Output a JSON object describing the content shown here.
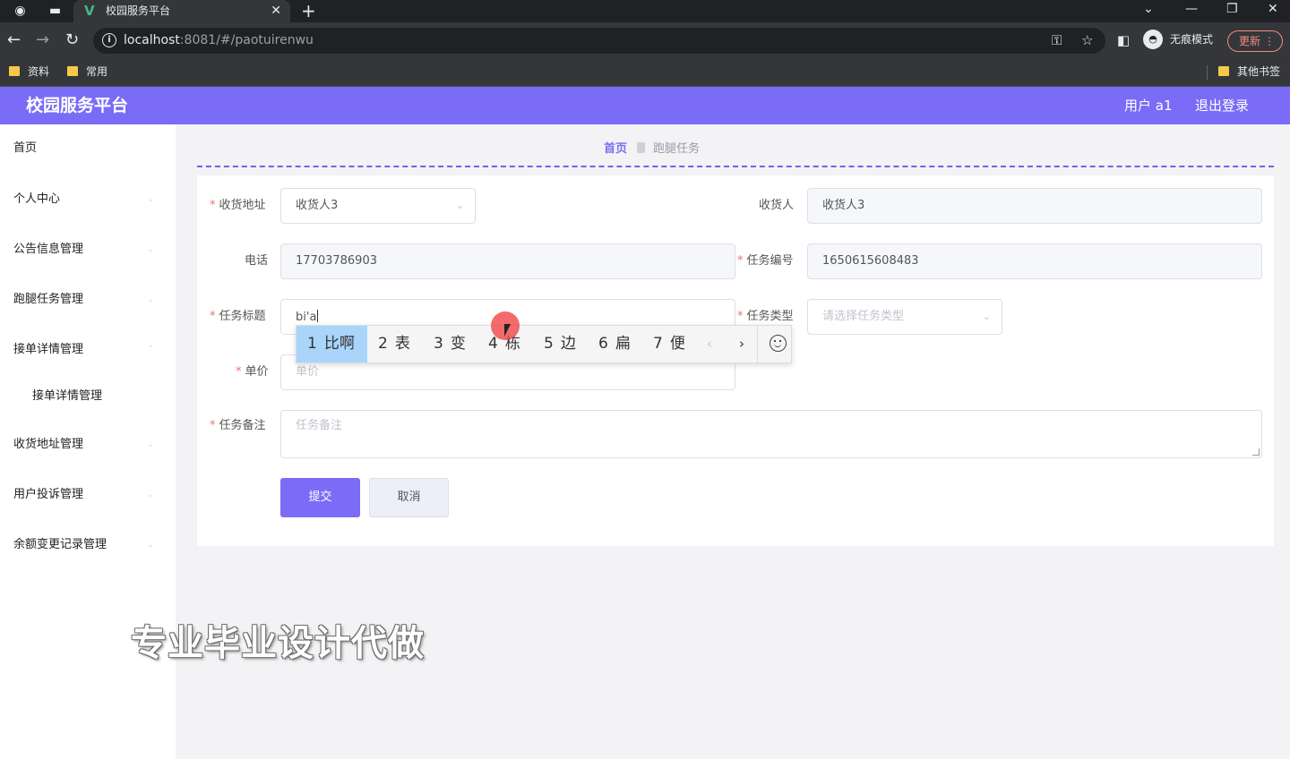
{
  "browser": {
    "tab_title": "校园服务平台",
    "url_host": "localhost",
    "url_rest": ":8081/#/paotuirenwu",
    "incognito_label": "无痕模式",
    "update_label": "更新",
    "bookmarks": [
      "资料",
      "常用"
    ],
    "other_bookmarks": "其他书签"
  },
  "header": {
    "title": "校园服务平台",
    "user": "用户 a1",
    "logout": "退出登录"
  },
  "sidebar": {
    "items": [
      {
        "label": "首页"
      },
      {
        "label": "个人中心"
      },
      {
        "label": "公告信息管理"
      },
      {
        "label": "跑腿任务管理"
      },
      {
        "label": "接单详情管理"
      },
      {
        "label": "接单详情管理"
      },
      {
        "label": "收货地址管理"
      },
      {
        "label": "用户投诉管理"
      },
      {
        "label": "余额变更记录管理"
      }
    ]
  },
  "breadcrumb": {
    "home": "首页",
    "current": "跑腿任务"
  },
  "form": {
    "address_label": "收货地址",
    "address_value": "收货人3",
    "receiver_label": "收货人",
    "receiver_value": "收货人3",
    "phone_label": "电话",
    "phone_value": "17703786903",
    "task_no_label": "任务编号",
    "task_no_value": "1650615608483",
    "title_label": "任务标题",
    "title_value": "bi'a",
    "type_label": "任务类型",
    "type_placeholder": "请选择任务类型",
    "price_label": "单价",
    "price_placeholder": "单价",
    "remark_label": "任务备注",
    "remark_placeholder": "任务备注",
    "submit_label": "提交",
    "cancel_label": "取消"
  },
  "ime": {
    "candidates": [
      {
        "n": "1",
        "text": "比啊"
      },
      {
        "n": "2",
        "text": "表"
      },
      {
        "n": "3",
        "text": "变"
      },
      {
        "n": "4",
        "text": "栋"
      },
      {
        "n": "5",
        "text": "边"
      },
      {
        "n": "6",
        "text": "扁"
      },
      {
        "n": "7",
        "text": "便"
      }
    ]
  },
  "watermark": "专业毕业设计代做"
}
